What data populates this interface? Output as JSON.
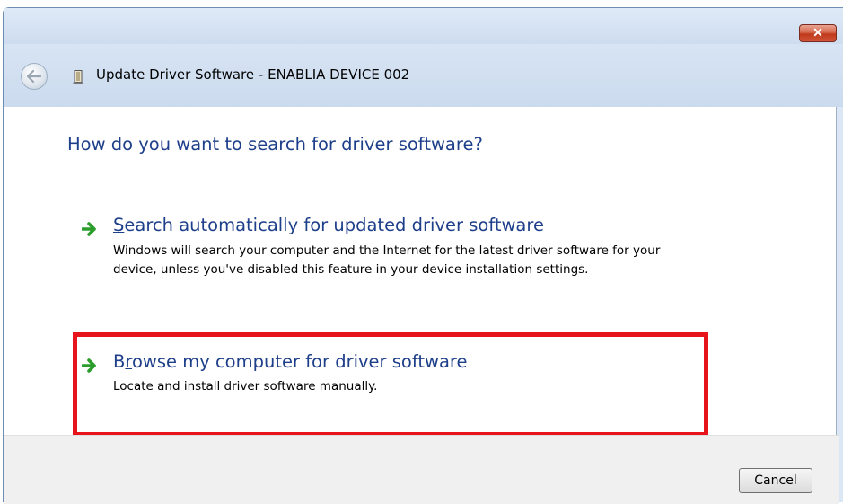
{
  "window": {
    "title": "Update Driver Software - ENABLIA DEVICE 002",
    "close_label": "✕"
  },
  "page": {
    "heading": "How do you want to search for driver software?"
  },
  "options": [
    {
      "title_access_key": "S",
      "title_rest": "earch automatically for updated driver software",
      "description": "Windows will search your computer and the Internet for the latest driver software for your device, unless you've disabled this feature in your device installation settings."
    },
    {
      "title_pre": "B",
      "title_access_key": "r",
      "title_rest": "owse my computer for driver software",
      "description": "Locate and install driver software manually."
    }
  ],
  "footer": {
    "cancel_label": "Cancel"
  },
  "colors": {
    "heading": "#1e3f8a",
    "arrow": "#2a9d2a",
    "highlight": "#e8141c"
  },
  "icons": {
    "back": "back-arrow-icon",
    "device": "device-icon",
    "option_arrow": "green-arrow-icon"
  }
}
